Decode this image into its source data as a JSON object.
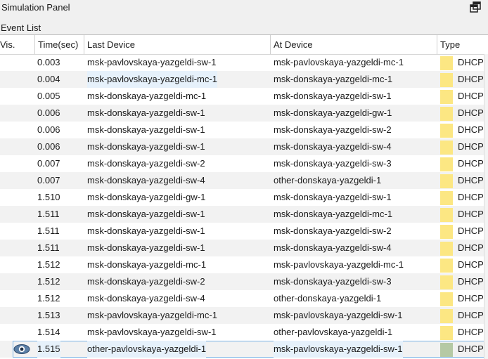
{
  "panel": {
    "title": "Simulation Panel"
  },
  "event_list": {
    "label": "Event List"
  },
  "columns": {
    "vis": "Vis.",
    "time": "Time(sec)",
    "last": "Last Device",
    "at": "At Device",
    "type": "Type"
  },
  "colors": {
    "dhcp_yellow": "#fce783",
    "dhcp_selected": "#b5c9a4",
    "selection_border": "#7ab4e6"
  },
  "rows": [
    {
      "time": "0.003",
      "last": "msk-pavlovskaya-yazgeldi-sw-1",
      "at": "msk-pavlovskaya-yazgeldi-mc-1",
      "type": "DHCP"
    },
    {
      "time": "0.004",
      "last": "msk-pavlovskaya-yazgeldi-mc-1",
      "at": "msk-donskaya-yazgeldi-mc-1",
      "type": "DHCP"
    },
    {
      "time": "0.005",
      "last": "msk-donskaya-yazgeldi-mc-1",
      "at": "msk-donskaya-yazgeldi-sw-1",
      "type": "DHCP"
    },
    {
      "time": "0.006",
      "last": "msk-donskaya-yazgeldi-sw-1",
      "at": "msk-donskaya-yazgeldi-gw-1",
      "type": "DHCP"
    },
    {
      "time": "0.006",
      "last": "msk-donskaya-yazgeldi-sw-1",
      "at": "msk-donskaya-yazgeldi-sw-2",
      "type": "DHCP"
    },
    {
      "time": "0.006",
      "last": "msk-donskaya-yazgeldi-sw-1",
      "at": "msk-donskaya-yazgeldi-sw-4",
      "type": "DHCP"
    },
    {
      "time": "0.007",
      "last": "msk-donskaya-yazgeldi-sw-2",
      "at": "msk-donskaya-yazgeldi-sw-3",
      "type": "DHCP"
    },
    {
      "time": "0.007",
      "last": "msk-donskaya-yazgeldi-sw-4",
      "at": "other-donskaya-yazgeldi-1",
      "type": "DHCP"
    },
    {
      "time": "1.510",
      "last": "msk-donskaya-yazgeldi-gw-1",
      "at": "msk-donskaya-yazgeldi-sw-1",
      "type": "DHCP"
    },
    {
      "time": "1.511",
      "last": "msk-donskaya-yazgeldi-sw-1",
      "at": "msk-donskaya-yazgeldi-mc-1",
      "type": "DHCP"
    },
    {
      "time": "1.511",
      "last": "msk-donskaya-yazgeldi-sw-1",
      "at": "msk-donskaya-yazgeldi-sw-2",
      "type": "DHCP"
    },
    {
      "time": "1.511",
      "last": "msk-donskaya-yazgeldi-sw-1",
      "at": "msk-donskaya-yazgeldi-sw-4",
      "type": "DHCP"
    },
    {
      "time": "1.512",
      "last": "msk-donskaya-yazgeldi-mc-1",
      "at": "msk-pavlovskaya-yazgeldi-mc-1",
      "type": "DHCP"
    },
    {
      "time": "1.512",
      "last": "msk-donskaya-yazgeldi-sw-2",
      "at": "msk-donskaya-yazgeldi-sw-3",
      "type": "DHCP"
    },
    {
      "time": "1.512",
      "last": "msk-donskaya-yazgeldi-sw-4",
      "at": "other-donskaya-yazgeldi-1",
      "type": "DHCP"
    },
    {
      "time": "1.513",
      "last": "msk-pavlovskaya-yazgeldi-mc-1",
      "at": "msk-pavlovskaya-yazgeldi-sw-1",
      "type": "DHCP"
    },
    {
      "time": "1.514",
      "last": "msk-pavlovskaya-yazgeldi-sw-1",
      "at": "other-pavlovskaya-yazgeldi-1",
      "type": "DHCP"
    },
    {
      "time": "1.515",
      "last": "other-pavlovskaya-yazgeldi-1",
      "at": "msk-pavlovskaya-yazgeldi-sw-1",
      "type": "DHCP",
      "selected": true
    }
  ]
}
